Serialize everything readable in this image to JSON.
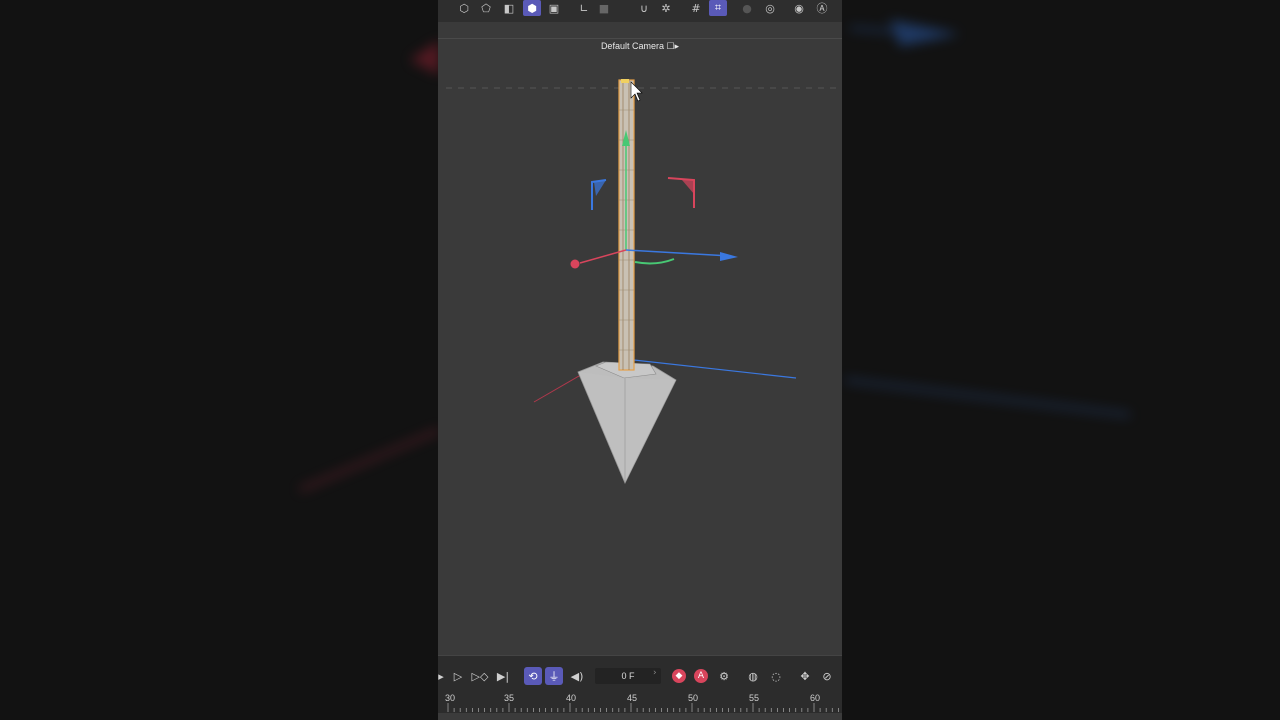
{
  "viewport": {
    "camera_label": "Default Camera ☐▸"
  },
  "toolbar": {
    "icons": [
      "points-mode-icon",
      "edges-mode-icon",
      "polygons-mode-icon",
      "model-mode-icon",
      "texture-mode-icon",
      "axis-mode-icon",
      "solo-icon",
      "snap-icon",
      "snap-settings-icon",
      "grid-icon",
      "workplane-icon",
      "lock-icon",
      "render-view-icon",
      "render-settings-icon",
      "ar-icon"
    ]
  },
  "timeline": {
    "frame_value": "0 F",
    "prev_arrow": "‹",
    "next_arrow": "›",
    "ruler_ticks": [
      "30",
      "35",
      "40",
      "45",
      "50",
      "55",
      "60"
    ],
    "record_label": "A"
  },
  "colors": {
    "accent": "#5a5ab8",
    "selection": "#e7a048",
    "axis_x": "#d8455c",
    "axis_y": "#48c874",
    "axis_z": "#3a78e0",
    "mesh": "#bdbdbd"
  }
}
